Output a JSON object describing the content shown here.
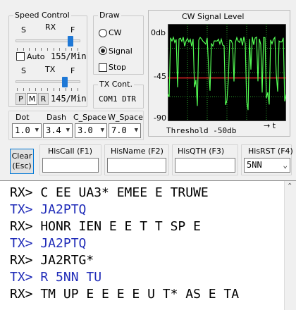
{
  "speed_control": {
    "title": "Speed Control",
    "rx_label": "RX",
    "tx_label": "TX",
    "s_label": "S",
    "f_label": "F",
    "rx_level": 0.88,
    "tx_level": 0.78,
    "auto_label": "Auto",
    "auto_checked": false,
    "rx_speed": "155/Min",
    "tx_speed": "145/Min",
    "mode_buttons": [
      "P",
      "M",
      "R"
    ],
    "active_mode": "M"
  },
  "draw": {
    "title": "Draw",
    "options": [
      "CW",
      "Signal"
    ],
    "selected": "Signal",
    "stop_label": "Stop",
    "stop_checked": false
  },
  "tx_cont": {
    "title": "TX Cont.",
    "port": "COM1 DTR"
  },
  "signal": {
    "title": "CW Signal Level",
    "y_labels": [
      "0db",
      "-45",
      "-90"
    ],
    "threshold_text": "Threshold -50db",
    "t_label": "→ t",
    "colors": {
      "background": "#000000",
      "grid": "#2aa22a",
      "trace": "#54ff54",
      "threshold": "#e02020"
    }
  },
  "timing": {
    "dot_label": "Dot",
    "dash_label": "Dash",
    "cspace_label": "C_Space",
    "wspace_label": "W_Space",
    "dot_value": "1.0",
    "dash_value": "3.4",
    "cspace_value": "3.0",
    "wspace_value": "7.0"
  },
  "clear_button": {
    "line1": "Clear",
    "line2": "(Esc)"
  },
  "fields": {
    "his_call_label": "HisCall  (F1)",
    "his_name_label": "HisName (F2)",
    "his_qth_label": "HisQTH (F3)",
    "his_rst_label": "HisRST (F4)",
    "his_call_value": "",
    "his_name_value": "",
    "his_qth_value": "",
    "his_rst_value": "5NN"
  },
  "log": {
    "lines": [
      {
        "text": "RX> C EE UA3* EMEE E TRUWE",
        "color": "#000000"
      },
      {
        "text": "TX> JA2PTQ",
        "color": "#1f2bb8"
      },
      {
        "text": "RX> HONR IEN E E T T SP E",
        "color": "#000000"
      },
      {
        "text": "TX> JA2PTQ",
        "color": "#1f2bb8"
      },
      {
        "text": "RX> JA2RTG*",
        "color": "#000000"
      },
      {
        "text": "TX> R 5NN TU",
        "color": "#1f2bb8"
      },
      {
        "text": "RX> TM UP E E E E U T* AS E TA",
        "color": "#000000"
      }
    ]
  }
}
